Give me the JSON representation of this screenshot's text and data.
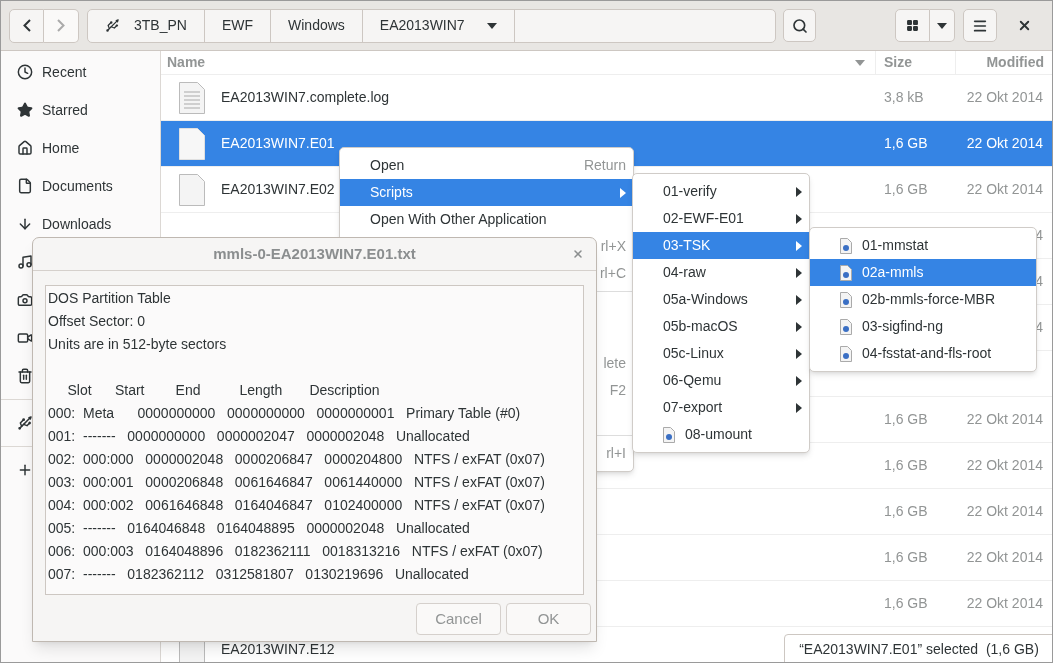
{
  "toolbar": {
    "back": {
      "disabled": false
    },
    "forward": {
      "disabled": true
    },
    "path": [
      {
        "label": "3TB_PN",
        "kind": "drive"
      },
      {
        "label": "EWF",
        "kind": "folder"
      },
      {
        "label": "Windows",
        "kind": "folder"
      },
      {
        "label": "EA2013WIN7",
        "kind": "current"
      }
    ]
  },
  "sidebar": {
    "items": [
      {
        "label": "Recent",
        "kind": "recent"
      },
      {
        "label": "Starred",
        "kind": "starred"
      },
      {
        "label": "Home",
        "kind": "home"
      },
      {
        "label": "Documents",
        "kind": "documents"
      },
      {
        "label": "Downloads",
        "kind": "downloads"
      },
      {
        "kind": "music"
      },
      {
        "kind": "pictures"
      },
      {
        "kind": "videos"
      },
      {
        "kind": "trash"
      },
      {
        "kind": "separator"
      },
      {
        "kind": "drive"
      },
      {
        "kind": "separator"
      },
      {
        "kind": "other"
      }
    ]
  },
  "table": {
    "columns": [
      "Name",
      "Size",
      "Modified"
    ],
    "rows": [
      {
        "kind": "text",
        "name": "EA2013WIN7.complete.log",
        "size": "3,8 kB",
        "modified": "22 Okt 2014",
        "selected": false
      },
      {
        "kind": "blank",
        "name": "EA2013WIN7.E01",
        "size": "1,6 GB",
        "modified": "22 Okt 2014",
        "selected": true
      },
      {
        "kind": "blank",
        "name": "EA2013WIN7.E02",
        "size": "1,6 GB",
        "modified": "22 Okt 2014",
        "selected": false
      },
      {
        "modified": "4",
        "selected": false
      },
      {
        "modified": "4",
        "selected": false
      },
      {
        "modified": "4",
        "selected": false
      },
      {
        "selected": false
      },
      {
        "size": "1,6 GB",
        "modified": "22 Okt 2014",
        "selected": false
      },
      {
        "size": "1,6 GB",
        "modified": "22 Okt 2014",
        "selected": false
      },
      {
        "size": "1,6 GB",
        "modified": "22 Okt 2014",
        "selected": false
      },
      {
        "size": "1,6 GB",
        "modified": "22 Okt 2014",
        "selected": false
      },
      {
        "size": "1,6 GB",
        "modified": "22 Okt 2014",
        "selected": false
      },
      {
        "kind": "blank",
        "name": "EA2013WIN7.E12",
        "selected": false
      }
    ]
  },
  "context_menu": {
    "items": [
      {
        "kind": "item",
        "label": "Open",
        "shortcut": "Return",
        "selected": false
      },
      {
        "kind": "submenu",
        "label": "Scripts",
        "selected": true
      },
      {
        "kind": "item",
        "label": "Open With Other Application",
        "selected": false
      },
      {
        "kind": "item",
        "shortcut": "rl+X",
        "selected": false
      },
      {
        "kind": "item",
        "shortcut": "rl+C",
        "selected": false
      },
      {
        "kind": "separator"
      },
      {
        "kind": "blank"
      },
      {
        "kind": "blank"
      },
      {
        "kind": "item",
        "shortcut": "lete",
        "selected": false
      },
      {
        "kind": "item",
        "shortcut": "F2",
        "selected": false
      },
      {
        "kind": "blank"
      },
      {
        "kind": "separator"
      },
      {
        "kind": "item",
        "shortcut": "rl+I",
        "selected": false
      }
    ]
  },
  "scripts_menu": {
    "items": [
      {
        "kind": "submenu",
        "label": "01-verify",
        "selected": false
      },
      {
        "kind": "submenu",
        "label": "02-EWF-E01",
        "selected": false
      },
      {
        "kind": "submenu",
        "label": "03-TSK",
        "selected": true
      },
      {
        "kind": "submenu",
        "label": "04-raw",
        "selected": false
      },
      {
        "kind": "submenu",
        "label": "05a-Windows",
        "selected": false
      },
      {
        "kind": "submenu",
        "label": "05b-macOS",
        "selected": false
      },
      {
        "kind": "submenu",
        "label": "05c-Linux",
        "selected": false
      },
      {
        "kind": "submenu",
        "label": "06-Qemu",
        "selected": false
      },
      {
        "kind": "submenu",
        "label": "07-export",
        "selected": false
      },
      {
        "kind": "script",
        "label": "08-umount",
        "selected": false
      }
    ]
  },
  "tsk_menu": {
    "items": [
      {
        "kind": "script",
        "label": "01-mmstat",
        "selected": false
      },
      {
        "kind": "script",
        "label": "02a-mmls",
        "selected": true
      },
      {
        "kind": "script",
        "label": "02b-mmls-force-MBR",
        "selected": false
      },
      {
        "kind": "script",
        "label": "03-sigfind-ng",
        "selected": false
      },
      {
        "kind": "script",
        "label": "04-fsstat-and-fls-root",
        "selected": false
      }
    ]
  },
  "dialog": {
    "title": "mmls-0-EA2013WIN7.E01.txt",
    "intro_lines": [
      "DOS Partition Table",
      "Offset Sector: 0",
      "Units are in 512-byte sectors"
    ],
    "table_lines": [
      "     Slot      Start        End          Length       Description",
      "000:  Meta      0000000000   0000000000   0000000001   Primary Table (#0)",
      "001:  -------   0000000000   0000002047   0000002048   Unallocated",
      "002:  000:000   0000002048   0000206847   0000204800   NTFS / exFAT (0x07)",
      "003:  000:001   0000206848   0061646847   0061440000   NTFS / exFAT (0x07)",
      "004:  000:002   0061646848   0164046847   0102400000   NTFS / exFAT (0x07)",
      "005:  -------   0164046848   0164048895   0000002048   Unallocated",
      "006:  000:003   0164048896   0182362111   0018313216   NTFS / exFAT (0x07)",
      "007:  -------   0182362112   0312581807   0130219696   Unallocated"
    ],
    "buttons": [
      {
        "label": "Cancel",
        "disabled": true
      },
      {
        "label": "OK",
        "disabled": true
      }
    ]
  },
  "status_bar": {
    "text": "“EA2013WIN7.E01” selected  (1,6 GB)"
  }
}
